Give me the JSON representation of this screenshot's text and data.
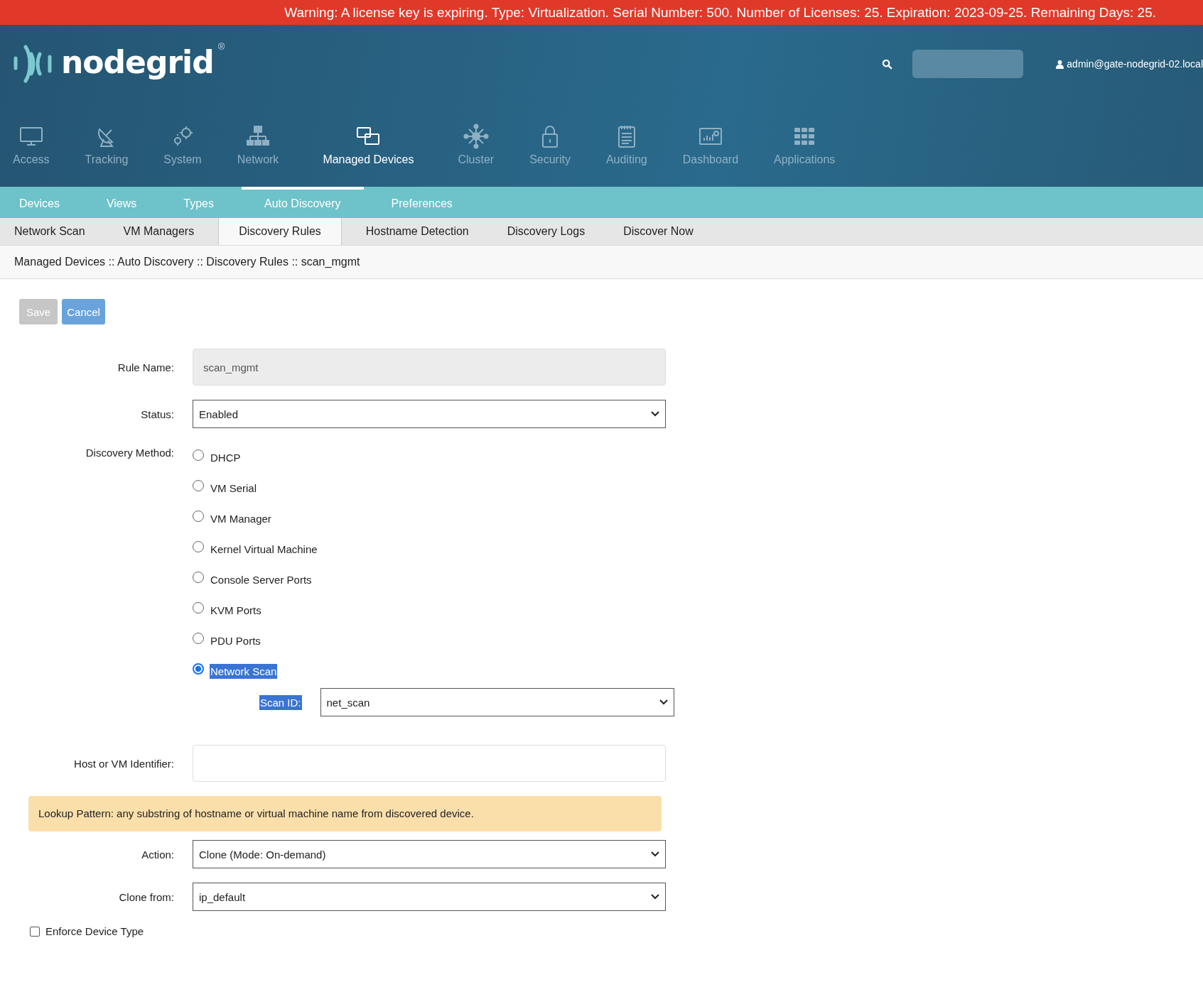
{
  "warning_banner": "Warning: A license key is expiring. Type: Virtualization. Serial Number: 500. Number of Licenses: 25. Expiration: 2023-09-25. Remaining Days: 25.",
  "header": {
    "logo_text": "nodegrid",
    "logo_mark": "®",
    "user": "admin@gate-nodegrid-02.local"
  },
  "main_nav": [
    {
      "label": "Access",
      "selected": false
    },
    {
      "label": "Tracking",
      "selected": false
    },
    {
      "label": "System",
      "selected": false
    },
    {
      "label": "Network",
      "selected": false
    },
    {
      "label": "Managed Devices",
      "selected": true
    },
    {
      "label": "Cluster",
      "selected": false
    },
    {
      "label": "Security",
      "selected": false
    },
    {
      "label": "Auditing",
      "selected": false
    },
    {
      "label": "Dashboard",
      "selected": false
    },
    {
      "label": "Applications",
      "selected": false
    }
  ],
  "sub_nav": [
    {
      "label": "Devices",
      "selected": false
    },
    {
      "label": "Views",
      "selected": false
    },
    {
      "label": "Types",
      "selected": false
    },
    {
      "label": "Auto Discovery",
      "selected": true
    },
    {
      "label": "Preferences",
      "selected": false
    }
  ],
  "tabs": [
    {
      "label": "Network Scan",
      "selected": false
    },
    {
      "label": "VM Managers",
      "selected": false
    },
    {
      "label": "Discovery Rules",
      "selected": true
    },
    {
      "label": "Hostname Detection",
      "selected": false
    },
    {
      "label": "Discovery Logs",
      "selected": false
    },
    {
      "label": "Discover Now",
      "selected": false
    }
  ],
  "breadcrumb": "Managed Devices :: Auto Discovery :: Discovery Rules :: scan_mgmt",
  "buttons": [
    {
      "label": "Save",
      "disabled": true
    },
    {
      "label": "Cancel",
      "disabled": false
    }
  ],
  "form": {
    "rule_name": {
      "label": "Rule Name:",
      "value": "scan_mgmt",
      "disabled": true
    },
    "status": {
      "label": "Status:",
      "value": "Enabled"
    },
    "discovery_method": {
      "label": "Discovery Method:",
      "options": [
        {
          "label": "DHCP",
          "selected": false,
          "highlighted": false
        },
        {
          "label": "VM Serial",
          "selected": false,
          "highlighted": false
        },
        {
          "label": "VM Manager",
          "selected": false,
          "highlighted": false
        },
        {
          "label": "Kernel Virtual Machine",
          "selected": false,
          "highlighted": false
        },
        {
          "label": "Console Server Ports",
          "selected": false,
          "highlighted": false
        },
        {
          "label": "KVM Ports",
          "selected": false,
          "highlighted": false
        },
        {
          "label": "PDU Ports",
          "selected": false,
          "highlighted": false
        },
        {
          "label": "Network Scan",
          "selected": true,
          "highlighted": true
        }
      ]
    },
    "scan_id": {
      "label": "Scan ID:",
      "value": "net_scan",
      "highlighted": true
    },
    "host_identifier": {
      "label": "Host or VM Identifier:"
    },
    "lookup_note": "Lookup Pattern: any substring of hostname or virtual machine name from discovered device.",
    "action": {
      "label": "Action:",
      "value": "Clone (Mode: On-demand)"
    },
    "clone_from": {
      "label": "Clone from:",
      "value": "ip_default"
    },
    "enforce_device_type": {
      "label": "Enforce Device Type",
      "checked": false
    }
  }
}
